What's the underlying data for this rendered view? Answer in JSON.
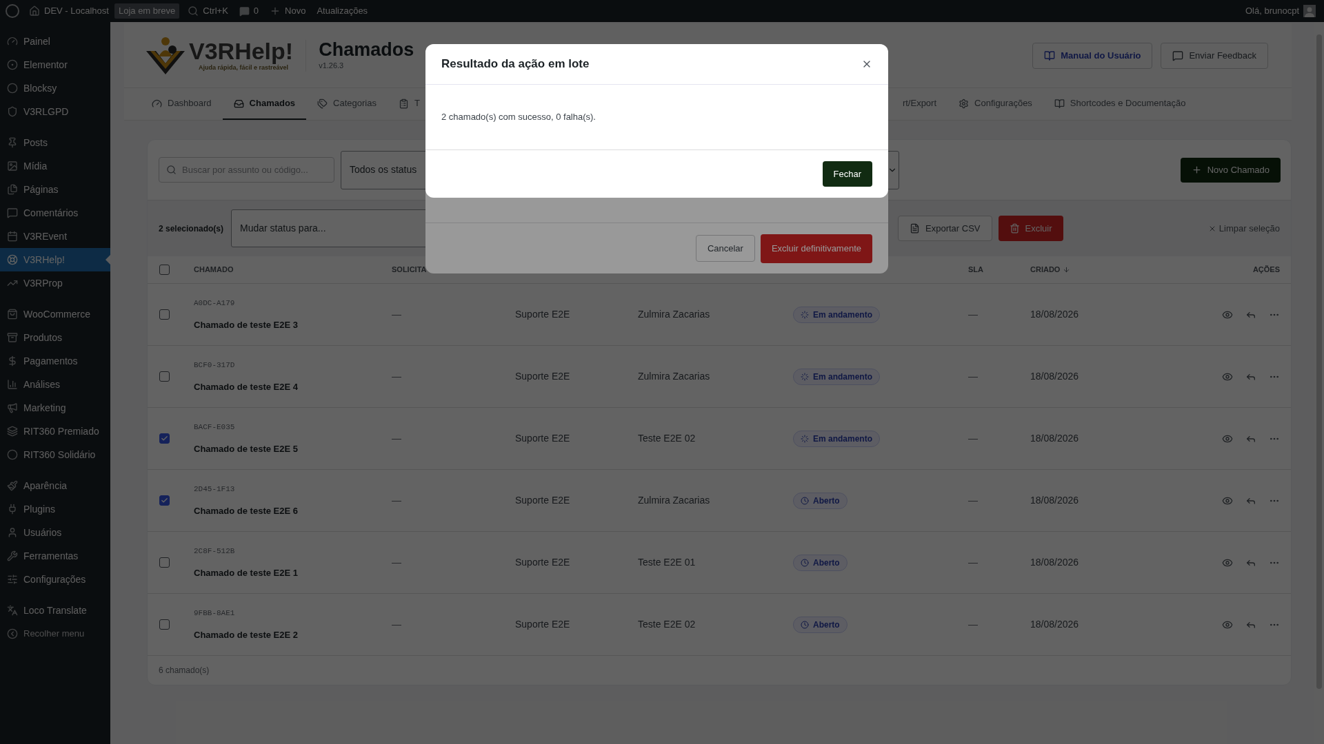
{
  "admin_bar": {
    "site": "DEV - Localhost",
    "badge": "Loja em breve",
    "search": "Ctrl+K",
    "comments": "0",
    "new": "Novo",
    "updates": "Atualizações",
    "greeting": "Olá, brunocpt"
  },
  "sidebar": {
    "sections": [
      {
        "items": [
          {
            "label": "Painel",
            "selected": false
          },
          {
            "label": "Elementor",
            "selected": false
          },
          {
            "label": "Blocksy",
            "selected": false
          },
          {
            "label": "V3RLGPD",
            "selected": false
          }
        ]
      },
      {
        "items": [
          {
            "label": "Posts",
            "selected": false
          },
          {
            "label": "Mídia",
            "selected": false
          },
          {
            "label": "Páginas",
            "selected": false
          },
          {
            "label": "Comentários",
            "selected": false
          },
          {
            "label": "V3REvent",
            "selected": false
          },
          {
            "label": "V3RHelp!",
            "selected": true
          },
          {
            "label": "V3RProp",
            "selected": false
          }
        ]
      },
      {
        "items": [
          {
            "label": "WooCommerce",
            "selected": false
          },
          {
            "label": "Produtos",
            "selected": false
          },
          {
            "label": "Pagamentos",
            "selected": false
          },
          {
            "label": "Análises",
            "selected": false
          },
          {
            "label": "Marketing",
            "selected": false
          },
          {
            "label": "RIT360 Premiado",
            "selected": false
          },
          {
            "label": "RIT360 Solidário",
            "selected": false
          }
        ]
      },
      {
        "items": [
          {
            "label": "Aparência",
            "selected": false
          },
          {
            "label": "Plugins",
            "selected": false
          },
          {
            "label": "Usuários",
            "selected": false
          },
          {
            "label": "Ferramentas",
            "selected": false
          },
          {
            "label": "Configurações",
            "selected": false
          }
        ]
      },
      {
        "items": [
          {
            "label": "Loco Translate",
            "selected": false
          },
          {
            "label": "Recolher menu",
            "selected": false
          }
        ]
      }
    ]
  },
  "header": {
    "logo": "V3R**Help!**",
    "tagline": "Ajuda rápida, fácil e rastreável",
    "title": "Chamados",
    "version": "v1.26.3",
    "buttons": [
      {
        "label": "Manual do Usuário",
        "kind": "link"
      },
      {
        "label": "Enviar Feedback",
        "kind": "plain"
      }
    ]
  },
  "tabs": [
    {
      "label": "Dashboard",
      "selected": false,
      "kind": "full"
    },
    {
      "label": "Chamados",
      "selected": true,
      "kind": "full"
    },
    {
      "label": "Categorias",
      "selected": false,
      "kind": "full"
    },
    {
      "label": "T",
      "selected": false,
      "kind": "cut_end"
    },
    {
      "label": "rt/Export",
      "selected": false,
      "kind": "cut_start"
    },
    {
      "label": "Configurações",
      "selected": false,
      "kind": "full"
    },
    {
      "label": "Shortcodes e Documentação",
      "selected": false,
      "kind": "full"
    }
  ],
  "toolbar": {
    "search_placeholder": "Buscar por assunto ou código...",
    "status_filter": "Todos os status",
    "new_button": "Novo Chamado"
  },
  "bulk_bar": {
    "count": "2 selecionado(s)",
    "status_select": "Mudar status para...",
    "export": "Exportar CSV",
    "delete": "Excluir",
    "clear": "Limpar seleção"
  },
  "table": {
    "header_checked": false,
    "headers": {
      "chamado": "CHAMADO",
      "column_2": "SOLICITA",
      "sla": "SLA",
      "criado": "CRIADO",
      "acoes": "AÇÕES"
    },
    "rows": [
      {
        "checked": false,
        "code": "A0DC-A179",
        "title": "Chamado de teste E2E 3",
        "requester": "—",
        "column_3": "Suporte E2E",
        "column_4": "Zulmira Zacarias",
        "status": {
          "label": "Em andamento",
          "kind": "in_progress"
        },
        "sla": "—",
        "created": "18/08/2026"
      },
      {
        "checked": false,
        "code": "BCF0-317D",
        "title": "Chamado de teste E2E 4",
        "requester": "—",
        "column_3": "Suporte E2E",
        "column_4": "Zulmira Zacarias",
        "status": {
          "label": "Em andamento",
          "kind": "in_progress"
        },
        "sla": "—",
        "created": "18/08/2026"
      },
      {
        "checked": true,
        "code": "BACF-E035",
        "title": "Chamado de teste E2E 5",
        "requester": "—",
        "column_3": "Suporte E2E",
        "column_4": "Teste E2E 02",
        "status": {
          "label": "Em andamento",
          "kind": "in_progress"
        },
        "sla": "—",
        "created": "18/08/2026"
      },
      {
        "checked": true,
        "code": "2D45-1F13",
        "title": "Chamado de teste E2E 6",
        "requester": "—",
        "column_3": "Suporte E2E",
        "column_4": "Zulmira Zacarias",
        "status": {
          "label": "Aberto",
          "kind": "open"
        },
        "sla": "—",
        "created": "18/08/2026"
      },
      {
        "checked": false,
        "code": "2C8F-512B",
        "title": "Chamado de teste E2E 1",
        "requester": "—",
        "column_3": "Suporte E2E",
        "column_4": "Teste E2E 01",
        "status": {
          "label": "Aberto",
          "kind": "open"
        },
        "sla": "—",
        "created": "18/08/2026"
      },
      {
        "checked": false,
        "code": "9FBB-8AE1",
        "title": "Chamado de teste E2E 2",
        "requester": "—",
        "column_3": "Suporte E2E",
        "column_4": "Teste E2E 02",
        "status": {
          "label": "Aberto",
          "kind": "open"
        },
        "sla": "—",
        "created": "18/08/2026"
      }
    ],
    "footer": "6 chamado(s)"
  },
  "confirm_dialog": {
    "cancel": "Cancelar",
    "confirm": "Excluir definitivamente"
  },
  "result_dialog": {
    "title": "Resultado da ação em lote",
    "message": "2 chamado(s) com sucesso, 0 falha(s).",
    "close": "Fechar"
  }
}
